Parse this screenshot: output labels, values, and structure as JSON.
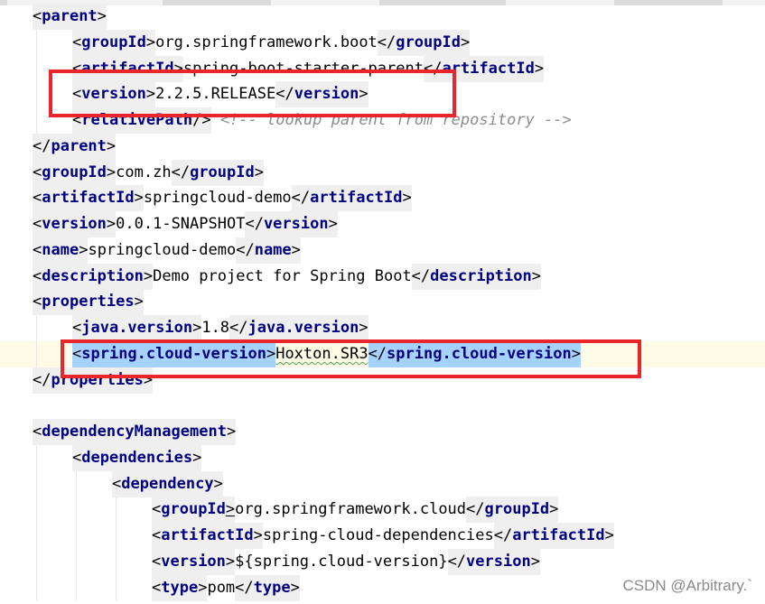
{
  "editor": {
    "lines": [
      [
        {
          "c": "tag",
          "t": "<"
        },
        {
          "c": "name",
          "t": "parent"
        },
        {
          "c": "tag",
          "t": ">"
        }
      ],
      [
        {
          "c": "tag",
          "t": "<"
        },
        {
          "c": "name",
          "t": "groupId"
        },
        {
          "c": "tag",
          "t": ">"
        },
        {
          "c": "text",
          "t": "org.springframework.boot"
        },
        {
          "c": "tag",
          "t": "</"
        },
        {
          "c": "name",
          "t": "groupId"
        },
        {
          "c": "tag",
          "t": ">"
        }
      ],
      [
        {
          "c": "tag",
          "t": "<"
        },
        {
          "c": "name",
          "t": "artifactId"
        },
        {
          "c": "tag",
          "t": ">"
        },
        {
          "c": "text",
          "t": "spring-boot-starter-parent"
        },
        {
          "c": "tag",
          "t": "</"
        },
        {
          "c": "name",
          "t": "artifactId"
        },
        {
          "c": "tag",
          "t": ">"
        }
      ],
      [
        {
          "c": "tag",
          "t": "<"
        },
        {
          "c": "name",
          "t": "version"
        },
        {
          "c": "tag",
          "t": ">"
        },
        {
          "c": "text",
          "t": "2.2.5.RELEASE"
        },
        {
          "c": "tag",
          "t": "</"
        },
        {
          "c": "name",
          "t": "version"
        },
        {
          "c": "tag",
          "t": ">"
        }
      ],
      [
        {
          "c": "tag",
          "t": "<"
        },
        {
          "c": "name",
          "t": "relativePath"
        },
        {
          "c": "tag",
          "t": "/>"
        },
        {
          "c": "text",
          "t": " "
        },
        {
          "c": "comment",
          "t": "<!-- lookup parent from repository -->"
        }
      ],
      [
        {
          "c": "tag",
          "t": "</"
        },
        {
          "c": "name",
          "t": "parent"
        },
        {
          "c": "tag",
          "t": ">"
        }
      ],
      [
        {
          "c": "tag",
          "t": "<"
        },
        {
          "c": "name",
          "t": "groupId"
        },
        {
          "c": "tag",
          "t": ">"
        },
        {
          "c": "text",
          "t": "com.zh"
        },
        {
          "c": "tag",
          "t": "</"
        },
        {
          "c": "name",
          "t": "groupId"
        },
        {
          "c": "tag",
          "t": ">"
        }
      ],
      [
        {
          "c": "tag",
          "t": "<"
        },
        {
          "c": "name",
          "t": "artifactId"
        },
        {
          "c": "tag",
          "t": ">"
        },
        {
          "c": "text",
          "t": "springcloud-demo"
        },
        {
          "c": "tag",
          "t": "</"
        },
        {
          "c": "name",
          "t": "artifactId"
        },
        {
          "c": "tag",
          "t": ">"
        }
      ],
      [
        {
          "c": "tag",
          "t": "<"
        },
        {
          "c": "name",
          "t": "version"
        },
        {
          "c": "tag",
          "t": ">"
        },
        {
          "c": "text",
          "t": "0.0.1-SNAPSHOT"
        },
        {
          "c": "tag",
          "t": "</"
        },
        {
          "c": "name",
          "t": "version"
        },
        {
          "c": "tag",
          "t": ">"
        }
      ],
      [
        {
          "c": "tag",
          "t": "<"
        },
        {
          "c": "name",
          "t": "name"
        },
        {
          "c": "tag",
          "t": ">"
        },
        {
          "c": "text",
          "t": "springcloud-demo"
        },
        {
          "c": "tag",
          "t": "</"
        },
        {
          "c": "name",
          "t": "name"
        },
        {
          "c": "tag",
          "t": ">"
        }
      ],
      [
        {
          "c": "tag",
          "t": "<"
        },
        {
          "c": "name",
          "t": "description"
        },
        {
          "c": "tag",
          "t": ">"
        },
        {
          "c": "text",
          "t": "Demo project for Spring Boot"
        },
        {
          "c": "tag",
          "t": "</"
        },
        {
          "c": "name",
          "t": "description"
        },
        {
          "c": "tag",
          "t": ">"
        }
      ],
      [
        {
          "c": "tag",
          "t": "<"
        },
        {
          "c": "name",
          "t": "properties"
        },
        {
          "c": "tag",
          "t": ">"
        }
      ],
      [
        {
          "c": "tag",
          "t": "<"
        },
        {
          "c": "name",
          "t": "java.version"
        },
        {
          "c": "tag",
          "t": ">"
        },
        {
          "c": "text",
          "t": "1.8"
        },
        {
          "c": "tag",
          "t": "</"
        },
        {
          "c": "name",
          "t": "java.version"
        },
        {
          "c": "tag",
          "t": ">"
        }
      ],
      [
        {
          "c": "tag",
          "t": "<",
          "sel": true
        },
        {
          "c": "name",
          "t": "spring.cloud-version",
          "sel": true
        },
        {
          "c": "tag",
          "t": ">",
          "sel": true
        },
        {
          "c": "text",
          "t": "Hoxton.SR3",
          "squiggle": true
        },
        {
          "c": "tag",
          "t": "</",
          "sel": true
        },
        {
          "c": "name",
          "t": "spring.cloud-version",
          "sel": true
        },
        {
          "c": "tag",
          "t": ">",
          "sel": true
        }
      ],
      [
        {
          "c": "tag",
          "t": "</"
        },
        {
          "c": "name",
          "t": "properties"
        },
        {
          "c": "tag",
          "t": ">"
        }
      ],
      [],
      [
        {
          "c": "tag",
          "t": "<"
        },
        {
          "c": "name",
          "t": "dependencyManagement"
        },
        {
          "c": "tag",
          "t": ">"
        }
      ],
      [
        {
          "c": "tag",
          "t": "<"
        },
        {
          "c": "name",
          "t": "dependencies"
        },
        {
          "c": "tag",
          "t": ">"
        }
      ],
      [
        {
          "c": "tag",
          "t": "<"
        },
        {
          "c": "name",
          "t": "dependency"
        },
        {
          "c": "tag",
          "t": ">"
        }
      ],
      [
        {
          "c": "tag",
          "t": "<"
        },
        {
          "c": "name",
          "t": "groupId"
        },
        {
          "c": "tag",
          "t": ">",
          "uline": true
        },
        {
          "c": "text",
          "t": "org.springframework.cloud"
        },
        {
          "c": "tag",
          "t": "</"
        },
        {
          "c": "name",
          "t": "groupId"
        },
        {
          "c": "tag",
          "t": ">"
        }
      ],
      [
        {
          "c": "tag",
          "t": "<"
        },
        {
          "c": "name",
          "t": "artifactId"
        },
        {
          "c": "tag",
          "t": ">"
        },
        {
          "c": "text",
          "t": "spring-cloud-dependencies"
        },
        {
          "c": "tag",
          "t": "</"
        },
        {
          "c": "name",
          "t": "artifactId"
        },
        {
          "c": "tag",
          "t": ">"
        }
      ],
      [
        {
          "c": "tag",
          "t": "<"
        },
        {
          "c": "name",
          "t": "version"
        },
        {
          "c": "tag",
          "t": ">"
        },
        {
          "c": "text",
          "t": "${spring.cloud-version}"
        },
        {
          "c": "tag",
          "t": "</"
        },
        {
          "c": "name",
          "t": "version"
        },
        {
          "c": "tag",
          "t": ">"
        }
      ],
      [
        {
          "c": "tag",
          "t": "<"
        },
        {
          "c": "name",
          "t": "type"
        },
        {
          "c": "tag",
          "t": ">"
        },
        {
          "c": "text",
          "t": "pom"
        },
        {
          "c": "tag",
          "t": "</"
        },
        {
          "c": "name",
          "t": "type"
        },
        {
          "c": "tag",
          "t": ">"
        }
      ]
    ],
    "indent_levels": [
      0,
      1,
      1,
      1,
      1,
      0,
      0,
      0,
      0,
      0,
      0,
      0,
      1,
      1,
      0,
      0,
      0,
      1,
      2,
      3,
      3,
      3,
      3
    ],
    "highlight_boxes": [
      {
        "label": "version-highlight-box",
        "line": 3
      },
      {
        "label": "cloud-version-highlight-box",
        "line": 13
      }
    ],
    "caret_line": 13,
    "colors": {
      "tag_name": "#000080",
      "tag_background": "#efefef",
      "comment": "#8c8c8c",
      "selection": "#a6d2ff",
      "highlight_box": "#e8262b",
      "caret_line_background": "#fdfbe6"
    }
  },
  "watermark": {
    "text": "CSDN @Arbitrary.`"
  }
}
